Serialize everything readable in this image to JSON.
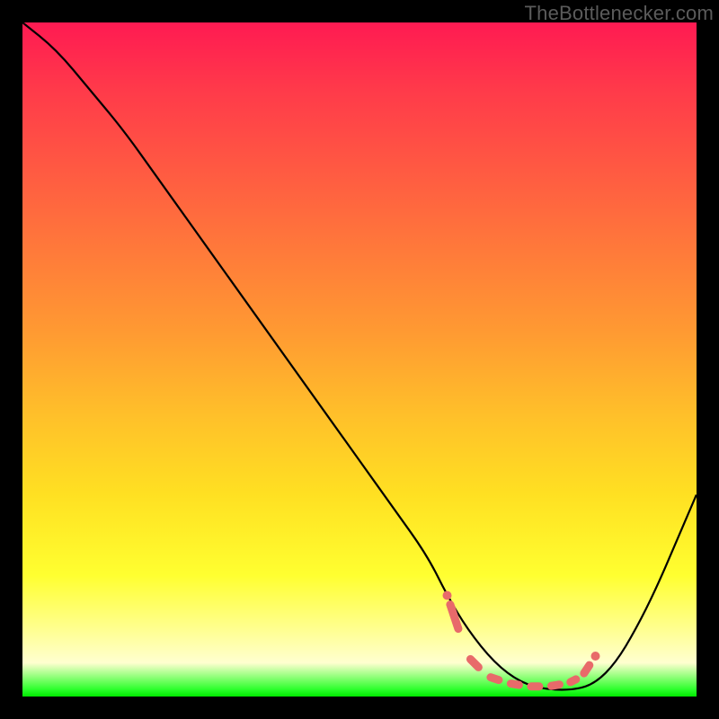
{
  "watermark": "TheBottlenecker.com",
  "colors": {
    "background": "#000000",
    "curve": "#000000",
    "marker": "#e86a6a",
    "watermark": "#5b5b5b"
  },
  "chart_data": {
    "type": "line",
    "title": "",
    "xlabel": "",
    "ylabel": "",
    "xlim": [
      0,
      100
    ],
    "ylim": [
      0,
      100
    ],
    "x": [
      0,
      5,
      10,
      15,
      20,
      25,
      30,
      35,
      40,
      45,
      50,
      55,
      60,
      63,
      66,
      70,
      74,
      78,
      82,
      85,
      88,
      91,
      94,
      97,
      100
    ],
    "values": [
      100,
      96,
      90,
      84,
      77,
      70,
      63,
      56,
      49,
      42,
      35,
      28,
      21,
      15,
      10,
      5,
      2,
      1,
      1,
      2,
      5,
      10,
      16,
      23,
      30
    ],
    "annotations_x": [
      63,
      66,
      69,
      72,
      75,
      78,
      81,
      83,
      85
    ],
    "annotations_y": [
      15,
      6,
      3,
      2,
      1.5,
      1.5,
      2,
      3,
      6
    ],
    "annotation_color": "#e86a6a",
    "gradient_colors": [
      "#ff1a52",
      "#ff9a32",
      "#ffff30",
      "#00e800"
    ]
  }
}
